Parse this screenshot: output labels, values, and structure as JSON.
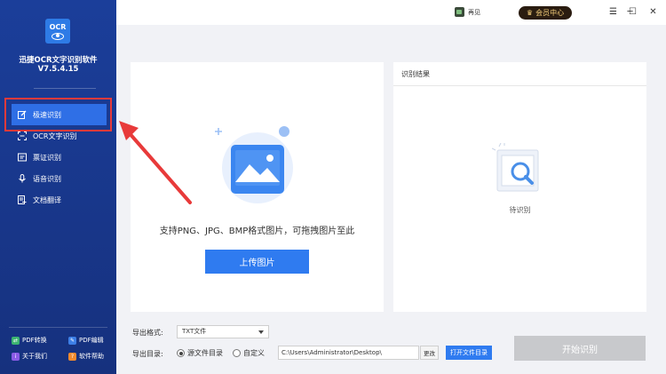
{
  "app": {
    "name": "迅捷OCR文字识别软件",
    "version": "V7.5.4.15",
    "logo_text": "OCR"
  },
  "sidebar": {
    "items": [
      {
        "label": "极速识别",
        "icon": "edit-icon"
      },
      {
        "label": "OCR文字识别",
        "icon": "scan-icon"
      },
      {
        "label": "票证识别",
        "icon": "ticket-icon"
      },
      {
        "label": "语音识别",
        "icon": "mic-icon"
      },
      {
        "label": "文档翻译",
        "icon": "translate-icon"
      }
    ],
    "active_index": 0,
    "links": [
      {
        "label": "PDF转换",
        "icon": "pdf-convert-icon",
        "color": "#3cb371"
      },
      {
        "label": "PDF编辑",
        "icon": "pdf-edit-icon",
        "color": "#3d7fe6"
      },
      {
        "label": "关于我们",
        "icon": "about-icon",
        "color": "#8a5be6"
      },
      {
        "label": "软件帮助",
        "icon": "help-icon",
        "color": "#f08a2e"
      }
    ]
  },
  "titlebar": {
    "feedback_label": "再见",
    "vip_label": "会员中心",
    "menu_glyph": "☰",
    "minimize_glyph": "─",
    "maximize_glyph": "☐",
    "close_glyph": "✕"
  },
  "upload": {
    "hint": "支持PNG、JPG、BMP格式图片，可拖拽图片至此",
    "button_label": "上传图片"
  },
  "result": {
    "header": "识别结果",
    "status": "待识别"
  },
  "controls": {
    "format_label": "导出格式:",
    "format_value": "TXT文件",
    "dir_label": "导出目录:",
    "radio_source": "源文件目录",
    "radio_custom": "自定义",
    "radio_selected": "source",
    "path_value": "C:\\Users\\Administrator\\Desktop\\",
    "change_label": "更改",
    "open_dir_label": "打开文件目录",
    "start_label": "开始识别"
  },
  "colors": {
    "sidebar_bg": "#1b3e9a",
    "accent": "#2f7bf0",
    "annotation": "#e83a3a",
    "vip_bg": "#2a1c10",
    "vip_text": "#f6cf7c",
    "disabled": "#c8c9cc"
  }
}
